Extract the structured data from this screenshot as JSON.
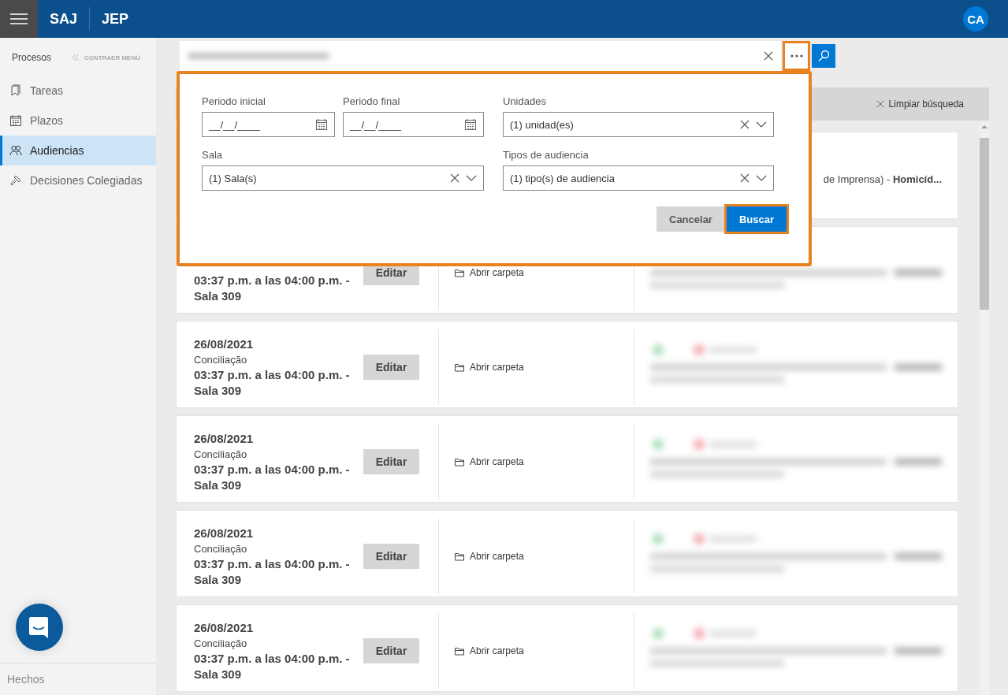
{
  "header": {
    "brand": "SAJ",
    "module": "JEP",
    "avatar": "CA"
  },
  "sidebar": {
    "section": "Procesos",
    "collapse": "CONTRAER MENÚ",
    "items": [
      {
        "label": "Tareas",
        "kind": "bookmark",
        "selected": false
      },
      {
        "label": "Plazos",
        "kind": "calendar",
        "selected": false
      },
      {
        "label": "Audiencias",
        "kind": "people",
        "selected": true
      },
      {
        "label": "Decisiones Colegiadas",
        "kind": "gavel",
        "selected": false
      }
    ],
    "footer": "Hechos"
  },
  "search": {
    "more_highlighted": true
  },
  "toolbar": {
    "clear_search": "Limpiar búsqueda"
  },
  "filter_panel": {
    "highlighted": true,
    "fields": [
      {
        "label": "Periodo inicial",
        "kind": "date",
        "value": "__/__/____"
      },
      {
        "label": "Periodo final",
        "kind": "date",
        "value": "__/__/____"
      },
      {
        "label": "Unidades",
        "kind": "select",
        "value": "(1) unidad(es)"
      },
      {
        "label": "Sala",
        "kind": "select",
        "value": "(1) Sala(s)"
      },
      {
        "label": "Tipos de audiencia",
        "kind": "select",
        "value": "(1) tipo(s) de audiencia"
      }
    ],
    "buttons": [
      {
        "label": "Cancelar",
        "kind": "secondary",
        "highlighted": false
      },
      {
        "label": "Buscar",
        "kind": "primary",
        "highlighted": true
      }
    ]
  },
  "cards": [
    {
      "snippet": "de Imprensa) - **Homicíd...**"
    },
    {
      "time": "03:37 p.m. a las 04:00 p.m. -",
      "room": "Sala 309",
      "edit": "Editar",
      "folder": "Abrir carpeta"
    },
    {
      "date": "26/08/2021",
      "type": "Conciliação",
      "time": "03:37 p.m. a las 04:00 p.m. -",
      "room": "Sala 309",
      "edit": "Editar",
      "folder": "Abrir carpeta"
    },
    {
      "date": "26/08/2021",
      "type": "Conciliação",
      "time": "03:37 p.m. a las 04:00 p.m. -",
      "room": "Sala 309",
      "edit": "Editar",
      "folder": "Abrir carpeta"
    },
    {
      "date": "26/08/2021",
      "type": "Conciliação",
      "time": "03:37 p.m. a las 04:00 p.m. -",
      "room": "Sala 309",
      "edit": "Editar",
      "folder": "Abrir carpeta"
    },
    {
      "date": "26/08/2021",
      "type": "Conciliação",
      "time": "03:37 p.m. a las 04:00 p.m. -",
      "room": "Sala 309",
      "edit": "Editar",
      "folder": "Abrir carpeta"
    }
  ]
}
